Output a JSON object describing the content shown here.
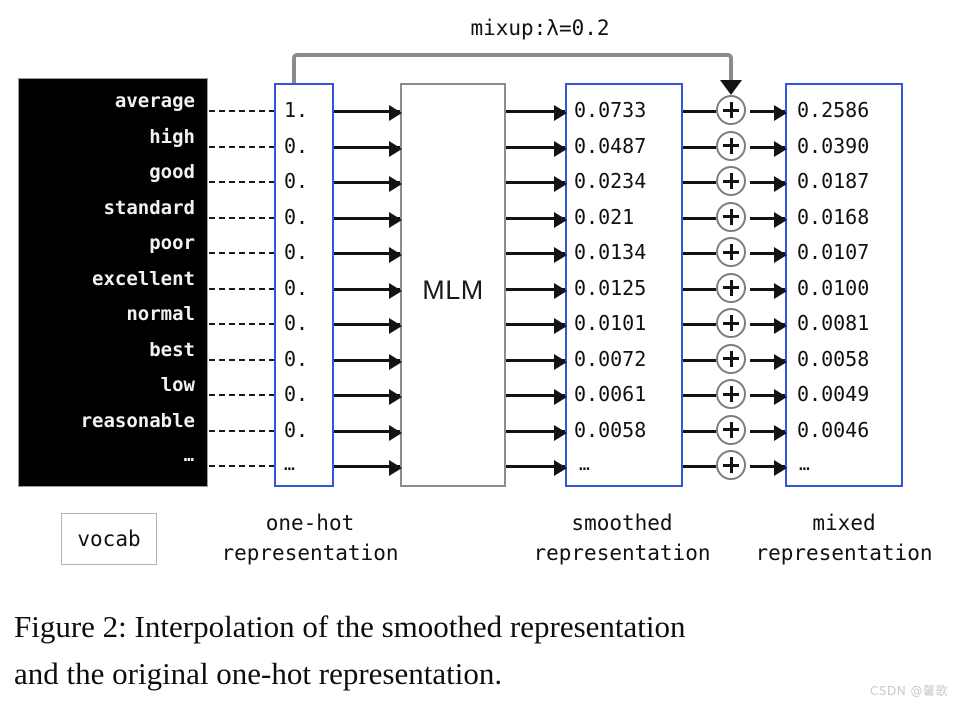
{
  "figure": {
    "mixup_label": "mixup:λ=0.2",
    "mlm_label": "MLM",
    "vocab_tag": "vocab",
    "captions": {
      "onehot_line1": "one-hot",
      "onehot_line2": "representation",
      "smoothed_line1": "smoothed",
      "smoothed_line2": "representation",
      "mixed_line1": "mixed",
      "mixed_line2": "representation"
    },
    "figure_caption_line1": "Figure 2: Interpolation of the smoothed representation",
    "figure_caption_line2": "and the original one-hot representation.",
    "watermark": "CSDN @馨歌",
    "colors": {
      "box_blue": "#3355dd",
      "box_gray": "#8c8c8c",
      "vocab_panel": "#000000",
      "arrow": "#131313",
      "bracket_gray": "#8a8a8a"
    }
  },
  "chart_data": {
    "type": "table",
    "title": "Interpolation of the smoothed representation and the original one-hot representation",
    "columns": [
      "vocab",
      "one-hot representation",
      "smoothed representation",
      "mixed representation"
    ],
    "rows": [
      {
        "vocab": "average",
        "one_hot": "1.",
        "smoothed": "0.0733",
        "mixed": "0.2586"
      },
      {
        "vocab": "high",
        "one_hot": "0.",
        "smoothed": "0.0487",
        "mixed": "0.0390"
      },
      {
        "vocab": "good",
        "one_hot": "0.",
        "smoothed": "0.0234",
        "mixed": "0.0187"
      },
      {
        "vocab": "standard",
        "one_hot": "0.",
        "smoothed": "0.021",
        "mixed": "0.0168"
      },
      {
        "vocab": "poor",
        "one_hot": "0.",
        "smoothed": "0.0134",
        "mixed": "0.0107"
      },
      {
        "vocab": "excellent",
        "one_hot": "0.",
        "smoothed": "0.0125",
        "mixed": "0.0100"
      },
      {
        "vocab": "normal",
        "one_hot": "0.",
        "smoothed": "0.0101",
        "mixed": "0.0081"
      },
      {
        "vocab": "best",
        "one_hot": "0.",
        "smoothed": "0.0072",
        "mixed": "0.0058"
      },
      {
        "vocab": "low",
        "one_hot": "0.",
        "smoothed": "0.0061",
        "mixed": "0.0049"
      },
      {
        "vocab": "reasonable",
        "one_hot": "0.",
        "smoothed": "0.0058",
        "mixed": "0.0046"
      },
      {
        "vocab": "…",
        "one_hot": "…",
        "smoothed": "…",
        "mixed": "…"
      }
    ],
    "lambda": 0.2,
    "operator": "+",
    "model": "MLM"
  }
}
